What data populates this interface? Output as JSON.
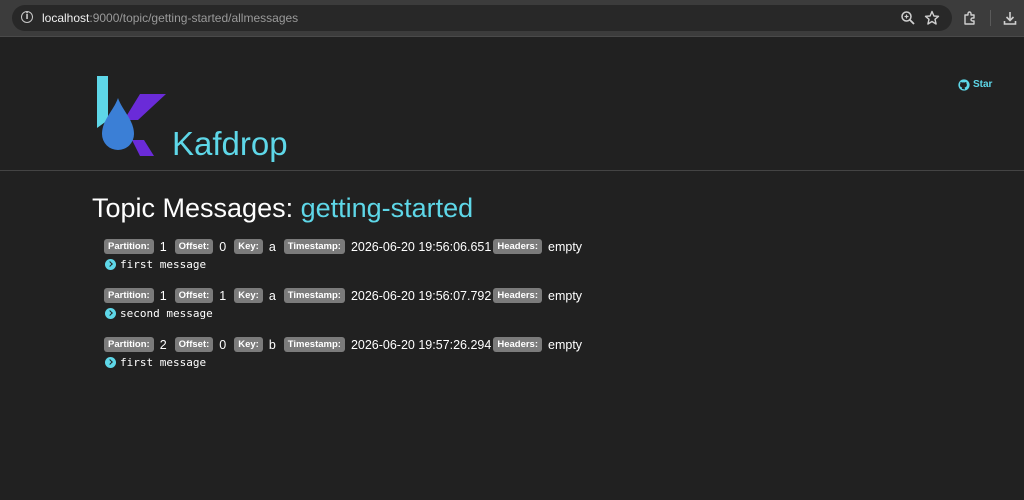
{
  "browser": {
    "url_host": "localhost",
    "url_rest": ":9000/topic/getting-started/allmessages"
  },
  "header": {
    "brand": "Kafdrop",
    "star_label": "Star"
  },
  "page": {
    "title_prefix": "Topic Messages: ",
    "topic": "getting-started"
  },
  "labels": {
    "partition": "Partition:",
    "offset": "Offset:",
    "key": "Key:",
    "timestamp": "Timestamp:",
    "headers": "Headers:"
  },
  "messages": [
    {
      "partition": "1",
      "offset": "0",
      "key": "a",
      "timestamp": "2026-06-20 19:56:06.651",
      "headers": "empty",
      "value": "first message"
    },
    {
      "partition": "1",
      "offset": "1",
      "key": "a",
      "timestamp": "2026-06-20 19:56:07.792",
      "headers": "empty",
      "value": "second message"
    },
    {
      "partition": "2",
      "offset": "0",
      "key": "b",
      "timestamp": "2026-06-20 19:57:26.294",
      "headers": "empty",
      "value": "first message"
    }
  ],
  "colors": {
    "accent": "#5ed7e8",
    "background": "#212121",
    "badge": "#7b7b7b",
    "logo_blue": "#3b7fd6",
    "logo_purple": "#6a2bd8"
  }
}
